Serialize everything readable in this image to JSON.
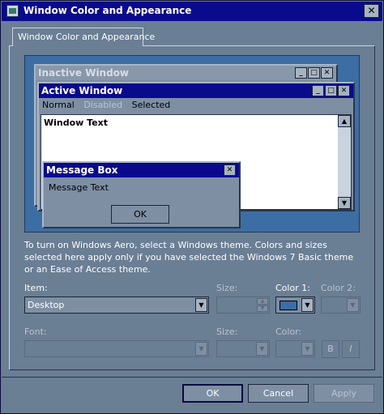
{
  "window": {
    "title": "Window Color and Appearance",
    "close_glyph": "✕"
  },
  "tab": {
    "label": "Window Color and Appearance"
  },
  "preview": {
    "inactive_title": "Inactive Window",
    "active_title": "Active Window",
    "menu": {
      "normal": "Normal",
      "disabled": "Disabled",
      "selected": "Selected"
    },
    "window_text": "Window Text",
    "message_box_title": "Message Box",
    "message_text": "Message Text",
    "ok_label": "OK",
    "min_glyph": "_",
    "max_glyph": "□",
    "close_glyph": "✕",
    "scroll_up": "▲",
    "scroll_down": "▼"
  },
  "info_text": "To turn on Windows Aero, select a Windows theme.  Colors and sizes selected here apply only if you have selected the Windows 7 Basic theme or an Ease of Access theme.",
  "item": {
    "label": "Item:",
    "value": "Desktop"
  },
  "size1": {
    "label": "Size:",
    "value": ""
  },
  "color1": {
    "label": "Color 1:",
    "value": "#3c6ea4"
  },
  "color2": {
    "label": "Color 2:"
  },
  "font": {
    "label": "Font:",
    "value": ""
  },
  "size2": {
    "label": "Size:",
    "value": ""
  },
  "color3": {
    "label": "Color:"
  },
  "bold_label": "B",
  "italic_label": "I",
  "buttons": {
    "ok": "OK",
    "cancel": "Cancel",
    "apply": "Apply"
  },
  "dropdown_arrow": "▼",
  "colors": {
    "dialog_bg": "#6a7e94",
    "title_bg": "#0a0a8c",
    "desktop": "#3c6ea4"
  }
}
